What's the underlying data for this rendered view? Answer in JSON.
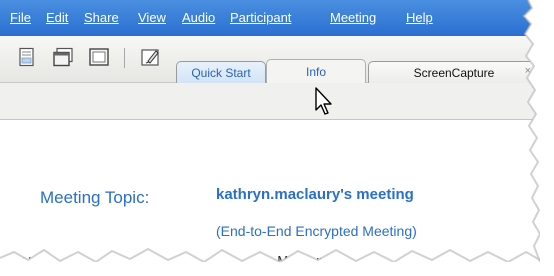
{
  "menu": [
    "File",
    "Edit",
    "Share",
    "View",
    "Audio",
    "Participant",
    "Meeting",
    "Help"
  ],
  "toolbar": {
    "icons": [
      "document-icon",
      "window-icon",
      "panel-icon",
      "edit-note-icon"
    ]
  },
  "tabs": {
    "quick_start": "Quick Start",
    "info": "Info",
    "screen_capture": "ScreenCapture",
    "close_symbol": "×"
  },
  "content": {
    "topic_label": "Meeting Topic:",
    "topic_value": "kathryn.maclaury's meeting",
    "topic_note": "(End-to-End Encrypted Meeting)",
    "cutoff_left": "Ho",
    "cutoff_right": "yn Maclaur"
  },
  "colors": {
    "menubar": "#3a80da",
    "accent_text": "#2a6fc9"
  }
}
